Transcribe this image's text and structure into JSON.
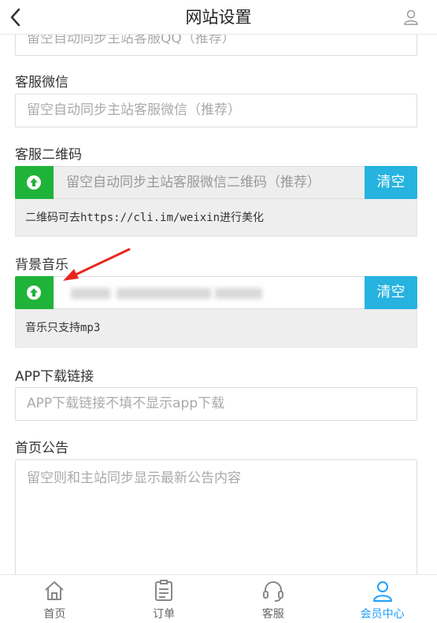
{
  "header": {
    "title": "网站设置"
  },
  "top_field": {
    "placeholder": "留空自动同步主站客服QQ（推荐）"
  },
  "wechat": {
    "label": "客服微信",
    "placeholder": "留空自动同步主站客服微信（推荐）"
  },
  "qrcode": {
    "label": "客服二维码",
    "placeholder": "留空自动同步主站客服微信二维码（推荐）",
    "clear_label": "清空",
    "note": "二维码可去https://cli.im/weixin进行美化"
  },
  "music": {
    "label": "背景音乐",
    "clear_label": "清空",
    "note": "音乐只支持mp3"
  },
  "app_link": {
    "label": "APP下载链接",
    "placeholder": "APP下载链接不填不显示app下载"
  },
  "notice": {
    "label": "首页公告",
    "placeholder": "留空则和主站同步显示最新公告内容"
  },
  "tabs": [
    {
      "label": "首页",
      "icon": "home-icon"
    },
    {
      "label": "订单",
      "icon": "clipboard-icon"
    },
    {
      "label": "客服",
      "icon": "headset-icon"
    },
    {
      "label": "会员中心",
      "icon": "user-icon"
    }
  ],
  "colors": {
    "green": "#1fb339",
    "blue": "#27b3e0",
    "active_tab": "#1e9fff",
    "arrow": "#e8251d"
  }
}
